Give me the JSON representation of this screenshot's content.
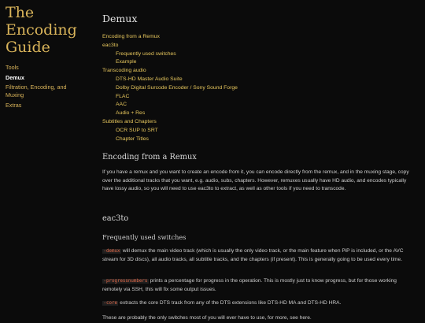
{
  "sidebar": {
    "title_line1": "The",
    "title_line2": "Encoding",
    "title_line3": "Guide",
    "nav": [
      {
        "label": "Tools"
      },
      {
        "label": "Demux"
      },
      {
        "label": "Filtration, Encoding, and"
      },
      {
        "label": "Muxing"
      },
      {
        "label": "Extras"
      }
    ]
  },
  "main": {
    "title": "Demux",
    "toc": [
      "Encoding from a Remux",
      "eac3to",
      "Frequently used switches",
      "Example",
      "Transcoding audio",
      "DTS-HD Master Audio Suite",
      "Dolby Digital Surcode Encoder / Sony Sound Forge",
      "FLAC",
      "AAC",
      "Audio + Res",
      "Subtitles and Chapters",
      "OCR SUP to SRT",
      "Chapter Titles"
    ],
    "section1_heading": "Encoding from a Remux",
    "section1_text": "If you have a remux and you want to create an encode from it, you can encode directly from the remux, and in the muxing stage, copy over the additional tracks that you want, e.g. audio, subs, chapters. However, remuxes usually have HD audio, and encodes typically have lossy audio, so you will need to use eac3to to extract, as well as other tools if you need to transcode.",
    "section2_heading": "eac3to",
    "subsection_heading": "Frequently used switches",
    "switch1_code": "-demux",
    "switch1_text": " will demux the main video track (which is usually the only video track, or the main feature when PiP is included, or the AVC stream for 3D discs), all audio tracks, all subtitle tracks, and the chapters (if present). This is generally going to be used every time.",
    "switch2_code": "-progressnumbers",
    "switch2_text": " prints a percentage for progress in the operation. This is mostly just to know progress, but for those working remotely via SSH, this will fix some output issues.",
    "switch3_code": "-core",
    "switch3_text": " extracts the core DTS track from any of the DTS extensions like DTS-HD MA and DTS-HD HRA.",
    "last_line": "These are probably the only switches most of you will ever have to use, for more, see here."
  }
}
